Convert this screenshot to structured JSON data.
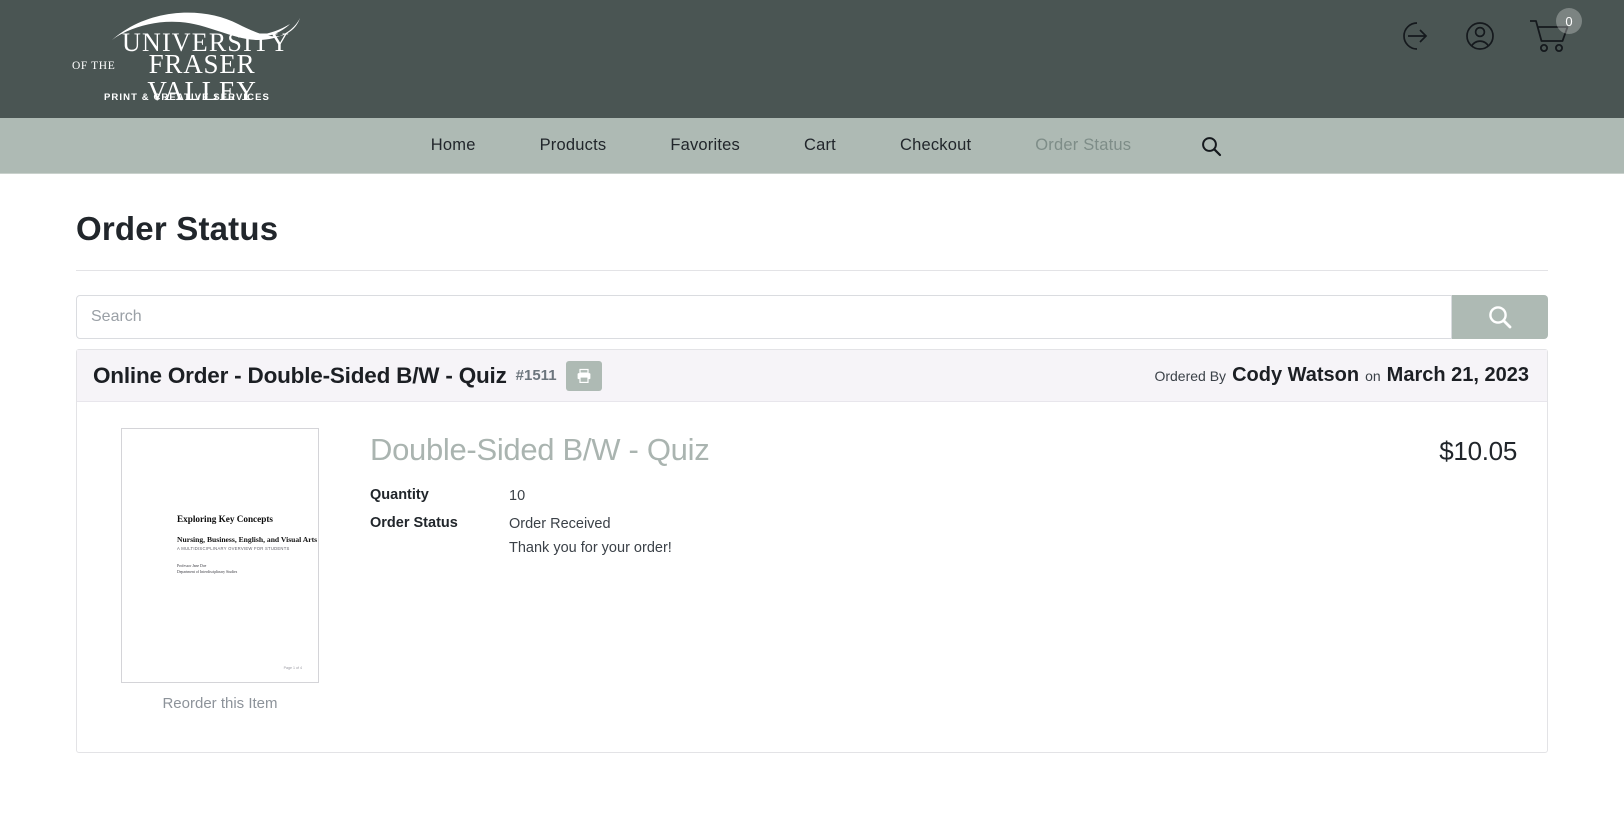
{
  "header": {
    "logo": {
      "line1": "UNIVERSITY",
      "of_the": "OF THE",
      "line2": "FRASER VALLEY",
      "tagline": "PRINT & CREATIVE SERVICES"
    },
    "icons": {
      "logout": "logout-icon",
      "account": "account-icon",
      "cart": "cart-icon"
    },
    "cart_count": "0",
    "bg_color": "#4a5553"
  },
  "nav": {
    "bg_color": "#aebab4",
    "items": [
      {
        "label": "Home",
        "current": false
      },
      {
        "label": "Products",
        "current": false
      },
      {
        "label": "Favorites",
        "current": false
      },
      {
        "label": "Cart",
        "current": false
      },
      {
        "label": "Checkout",
        "current": false
      },
      {
        "label": "Order Status",
        "current": true
      }
    ],
    "search_icon": "search-icon"
  },
  "page": {
    "title": "Order Status"
  },
  "search": {
    "value": "",
    "placeholder": "Search",
    "button_icon": "search-icon"
  },
  "order": {
    "title": "Online Order - Double-Sided B/W - Quiz",
    "number": "#1511",
    "print_icon": "printer-icon",
    "ordered_by_label": "Ordered By",
    "ordered_by_name": "Cody Watson",
    "on_label": "on",
    "ordered_date": "March 21, 2023",
    "item": {
      "name": "Double-Sided B/W - Quiz",
      "price": "$10.05",
      "reorder_label": "Reorder this Item",
      "specs": [
        {
          "label": "Quantity",
          "value": "10",
          "sub": ""
        },
        {
          "label": "Order Status",
          "value": "Order Received",
          "sub": "Thank you for your order!"
        }
      ],
      "thumbnail": {
        "title": "Exploring Key Concepts",
        "subtitle": "Nursing, Business, English, and Visual Arts",
        "subtitle2": "A MULTIDISCIPLINARY OVERVIEW FOR STUDENTS",
        "meta": "Professor Jane Doe\nDepartment of Interdisciplinary Studies",
        "footer": "Page 1 of 4"
      }
    }
  }
}
